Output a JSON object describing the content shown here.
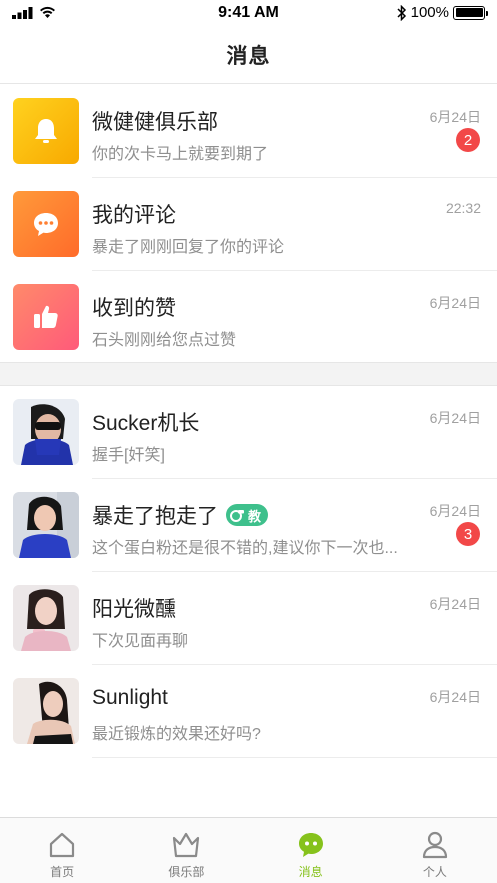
{
  "status_bar": {
    "time": "9:41 AM",
    "battery": "100%"
  },
  "header": {
    "title": "消息"
  },
  "system_messages": [
    {
      "title": "微健健俱乐部",
      "preview": "你的次卡马上就要到期了",
      "time": "6月24日",
      "badge": "2",
      "icon": "bell-icon"
    },
    {
      "title": "我的评论",
      "preview": "暴走了刚刚回复了你的评论",
      "time": "22:32",
      "icon": "comment-icon"
    },
    {
      "title": "收到的赞",
      "preview": "石头刚刚给您点过赞",
      "time": "6月24日",
      "icon": "thumbs-up-icon"
    }
  ],
  "chats": [
    {
      "name": "Sucker机长",
      "preview": "握手[奸笑]",
      "time": "6月24日"
    },
    {
      "name": "暴走了抱走了",
      "tag": "教",
      "preview": "这个蛋白粉还是很不错的,建议你下一次也...",
      "time": "6月24日",
      "badge": "3"
    },
    {
      "name": "阳光微醺",
      "preview": "下次见面再聊",
      "time": "6月24日"
    },
    {
      "name": "Sunlight",
      "preview": "最近锻炼的效果还好吗?",
      "time": "6月24日"
    }
  ],
  "tabs": [
    {
      "label": "首页",
      "icon": "home-icon"
    },
    {
      "label": "俱乐部",
      "icon": "crown-icon"
    },
    {
      "label": "消息",
      "icon": "message-icon",
      "active": true
    },
    {
      "label": "个人",
      "icon": "person-icon"
    }
  ],
  "colors": {
    "accent": "#86c21c",
    "badge": "#f24848",
    "coach_tag": "#3ec08c"
  }
}
